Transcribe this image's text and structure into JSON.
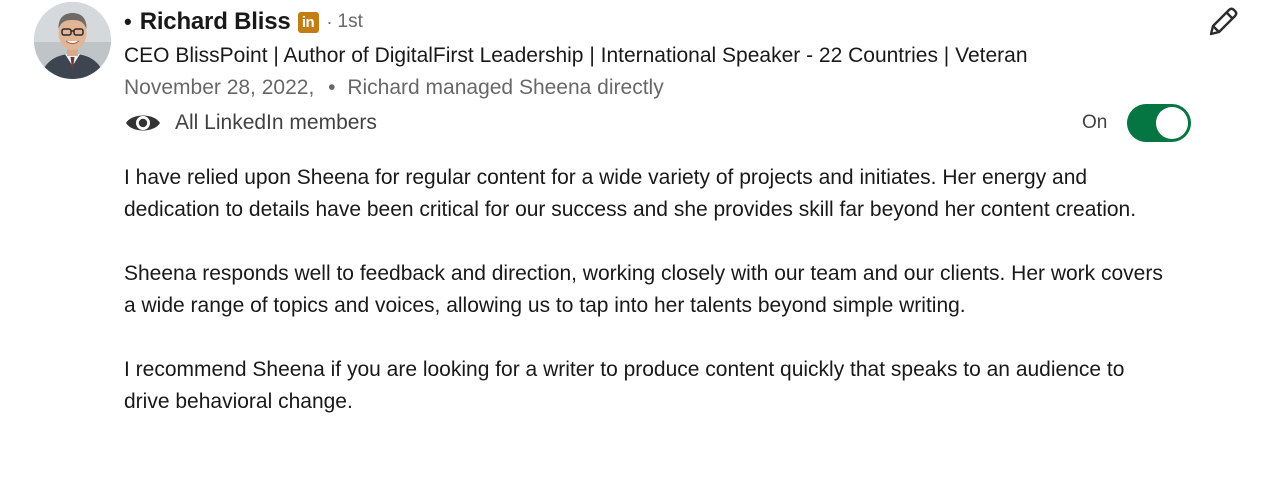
{
  "recommender": {
    "bullet": "•",
    "name": "Richard Bliss",
    "badge": "in",
    "separator": "·",
    "degree": "1st",
    "headline": "CEO BlissPoint | Author of DigitalFirst Leadership | International Speaker - 22 Countries | Veteran",
    "date": "November 28, 2022,",
    "meta_separator": "•",
    "relationship": "Richard managed Sheena directly"
  },
  "visibility": {
    "icon": "eye-icon",
    "label": "All LinkedIn members",
    "toggle_label": "On",
    "toggle_state": true
  },
  "actions": {
    "edit_icon": "pencil-icon"
  },
  "recommendation": {
    "paragraphs": [
      "I have relied upon Sheena for regular content for a wide variety of projects and initiates. Her energy and dedication to details have been critical for our success and she provides skill far beyond her content creation.",
      "Sheena responds well to feedback and direction, working closely with our team and our clients. Her work covers a wide range of topics and voices, allowing us to tap into her talents beyond simple writing.",
      "I recommend Sheena if you are looking for a writer to produce content quickly that speaks to an audience to drive behavioral change."
    ]
  },
  "colors": {
    "toggle_on": "#057642",
    "badge": "#c37d16",
    "secondary_text": "#666666"
  }
}
